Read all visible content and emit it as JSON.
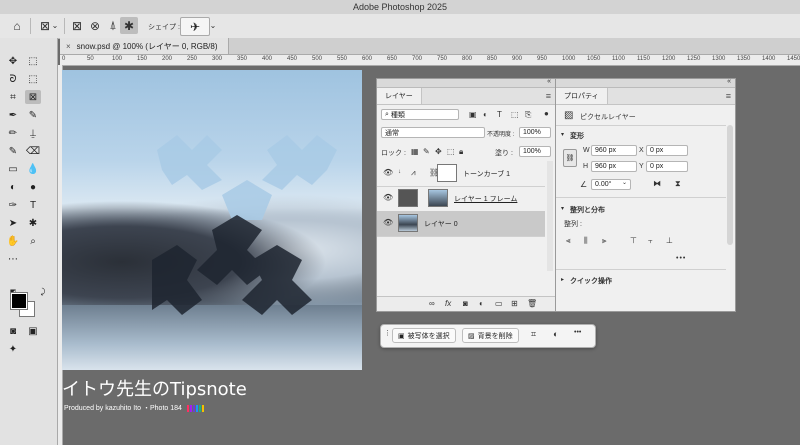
{
  "app": {
    "title": "Adobe Photoshop 2025"
  },
  "options_bar": {
    "shape_label": "シェイプ :"
  },
  "document_tab": {
    "label": "snow.psd @ 100% (レイヤー 0, RGB/8)",
    "close": "×"
  },
  "ruler": {
    "marks": [
      "0",
      "50",
      "100",
      "150",
      "200",
      "250",
      "300",
      "350",
      "400",
      "450",
      "500",
      "550",
      "600",
      "650",
      "700",
      "750",
      "800",
      "850",
      "900",
      "950",
      "1000",
      "1050",
      "1100",
      "1150",
      "1200",
      "1250",
      "1300",
      "1350",
      "1400",
      "1450",
      "1500",
      "1550",
      "1600",
      "1650",
      "1700",
      "1750",
      "1800",
      "1850",
      "1900",
      "1950",
      "2000",
      "2050",
      "2100",
      "2150",
      "2200",
      "2250",
      "2300",
      "2350",
      "2400",
      "2450",
      "2500",
      "2550",
      "2600",
      "2650",
      "2700",
      "2750",
      "2800",
      "2850",
      "2900",
      "2950",
      "3000"
    ]
  },
  "canvas": {
    "watermark_title": "イトウ先生のTipsnote",
    "watermark_sub": "Produced by kazuhito Ito ・Photo 184",
    "bar_colors": [
      "#ff2e63",
      "#a020f0",
      "#6c3bd6",
      "#1e90ff",
      "#14b87a",
      "#f2c200"
    ]
  },
  "layers_panel": {
    "tab": "レイヤー",
    "filter_value": "種類",
    "blend_mode": "通常",
    "opacity_label": "不透明度 :",
    "opacity_value": "100%",
    "lock_label": "ロック :",
    "fill_label": "塗り :",
    "fill_value": "100%",
    "layers": [
      {
        "name": "トーンカーブ 1"
      },
      {
        "name": "レイヤー 1 フレーム"
      },
      {
        "name": "レイヤー 0"
      }
    ]
  },
  "properties_panel": {
    "tab": "プロパティ",
    "type_label": "ピクセルレイヤー",
    "transform_heading": "変形",
    "w_label": "W",
    "w_value": "960 px",
    "h_label": "H",
    "h_value": "960 px",
    "x_label": "X",
    "x_value": "0 px",
    "y_label": "Y",
    "y_value": "0 px",
    "angle_value": "0.00°",
    "align_heading": "整列と分布",
    "align_sub": "整列 :",
    "more": "•••",
    "quick_heading": "クイック操作"
  },
  "taskbar": {
    "select_subject": "被写体を選択",
    "remove_bg": "背景を削除",
    "more": "•••"
  },
  "colors": {
    "foreground": "#000000",
    "background": "#ffffff",
    "snowflake": "#a9cbe6"
  }
}
